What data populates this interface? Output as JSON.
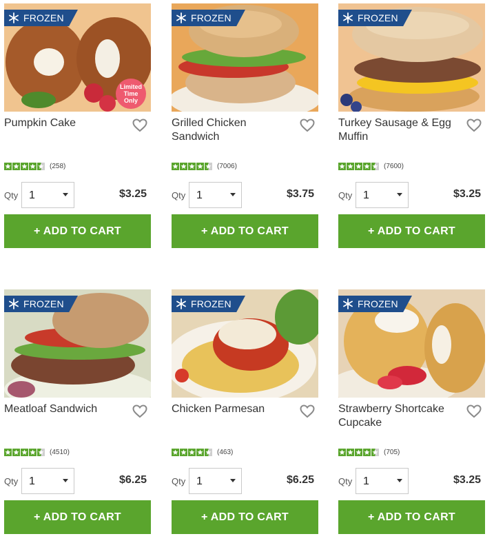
{
  "badge_label": "FROZEN",
  "qty_label": "Qty",
  "add_to_cart_label": "+ ADD TO CART",
  "limited_badge": [
    "Limited",
    "Time",
    "Only"
  ],
  "colors": {
    "accent_green": "#5aa52d",
    "badge_blue": "#1f4e8c",
    "limited_pink": "#ee5a6f"
  },
  "icons": {
    "badge": "snowflake-icon",
    "favorite": "heart-outline-icon",
    "dropdown": "chevron-down-icon"
  },
  "products": [
    {
      "name": "Pumpkin Cake",
      "rating": 4.5,
      "reviews": "(258)",
      "qty": "1",
      "price": "$3.25",
      "limited": true
    },
    {
      "name": "Grilled Chicken Sandwich",
      "rating": 4.5,
      "reviews": "(7006)",
      "qty": "1",
      "price": "$3.75",
      "limited": false
    },
    {
      "name": "Turkey Sausage & Egg Muffin",
      "rating": 4.5,
      "reviews": "(7600)",
      "qty": "1",
      "price": "$3.25",
      "limited": false
    },
    {
      "name": "Meatloaf Sandwich",
      "rating": 4.5,
      "reviews": "(4510)",
      "qty": "1",
      "price": "$6.25",
      "limited": false
    },
    {
      "name": "Chicken Parmesan",
      "rating": 4.5,
      "reviews": "(463)",
      "qty": "1",
      "price": "$6.25",
      "limited": false
    },
    {
      "name": "Strawberry Shortcake Cupcake",
      "rating": 4.5,
      "reviews": "(705)",
      "qty": "1",
      "price": "$3.25",
      "limited": false
    }
  ]
}
